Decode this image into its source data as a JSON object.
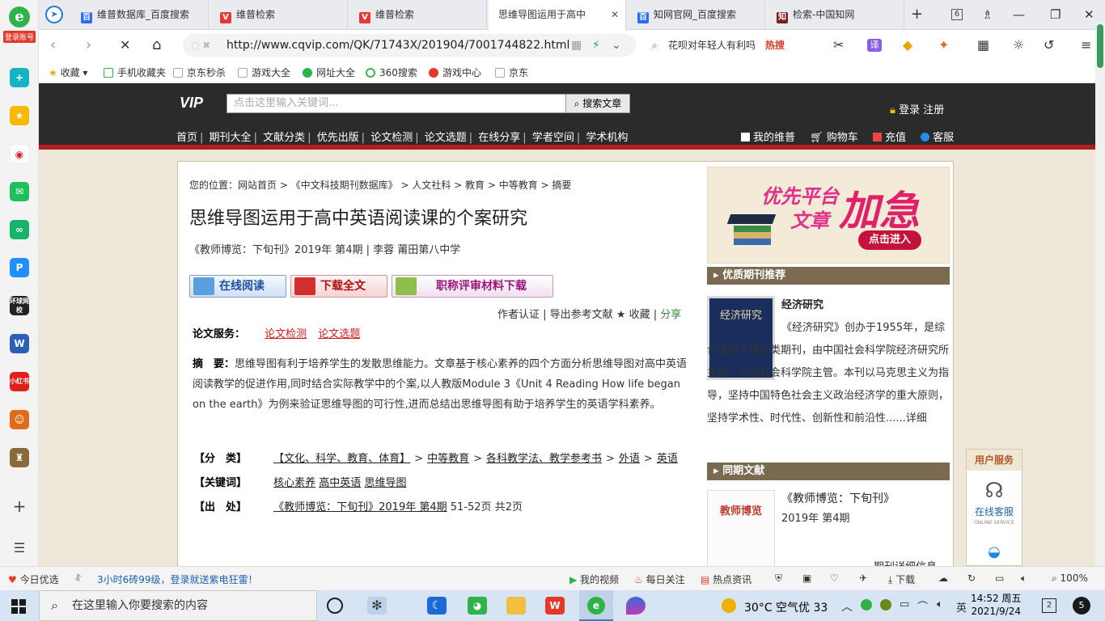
{
  "browser": {
    "sidebar": {
      "account_label": "登录账号",
      "icons": [
        "add-icon",
        "star-icon",
        "weibo-icon",
        "mail-icon",
        "link-icon",
        "p-app-icon",
        "global-school-icon",
        "word-doc-icon",
        "xiaohongshu-icon",
        "game-icon",
        "avatar-game-icon",
        "plus-icon",
        "list-icon"
      ],
      "global_school_label": "环球网校",
      "xiaohongshu_label": "小红书"
    },
    "tabs": [
      {
        "label": "维普数据库_百度搜索",
        "icon": "baidu-icon"
      },
      {
        "label": "维普检索",
        "icon": "weipu-icon"
      },
      {
        "label": "维普检索",
        "icon": "weipu-icon"
      },
      {
        "label": "思维导图运用于高中",
        "icon": "page-icon",
        "active": true
      },
      {
        "label": "知网官网_百度搜索",
        "icon": "baidu-icon"
      },
      {
        "label": "检索-中国知网",
        "icon": "cnki-icon"
      }
    ],
    "tab_count": "6",
    "url": "http://www.cqvip.com/QK/71743X/201904/7001744822.html",
    "search_text": "花呗对年轻人有利吗",
    "search_hot": "热搜",
    "bookmarks": [
      "收藏",
      "手机收藏夹",
      "京东秒杀",
      "游戏大全",
      "网址大全",
      "360搜索",
      "游戏中心",
      "京东"
    ]
  },
  "site": {
    "logo_text": "VIP",
    "search_placeholder": "点击这里输入关键词...",
    "search_button": "搜索文章",
    "login": "登录",
    "register": "注册",
    "nav": [
      "首页",
      "期刊大全",
      "文献分类",
      "优先出版",
      "论文检测",
      "论文选题",
      "在线分享",
      "学者空间",
      "学术机构"
    ],
    "tools": [
      "我的维普",
      "购物车",
      "充值",
      "客服"
    ]
  },
  "article": {
    "breadcrumb": "您的位置：网站首页 > 《中文科技期刊数据库》 > 人文社科 > 教育 > 中等教育 > 摘要",
    "title": "思维导图运用于高中英语阅读课的个案研究",
    "meta": "《教师博览：下旬刊》2019年 第4期 | 李蓉   莆田第八中学",
    "btn_read": "在线阅读",
    "btn_download": "下载全文",
    "btn_material": "职称评审材料下载",
    "author_auth": "作者认证",
    "export_ref": "导出参考文献",
    "collect": "★ 收藏",
    "share": "分享",
    "service_label": "论文服务：",
    "service_links": [
      "论文检测",
      "论文选题"
    ],
    "abstract_label": "摘　要：",
    "abstract_text": "思维导图有利于培养学生的发散思维能力。文章基于核心素养的四个方面分析思维导图对高中英语阅读教学的促进作用,同时结合实际教学中的个案,以人教版Module 3《Unit 4 Reading How life began on the earth》为例来验证思维导图的可行性,进而总结出思维导图有助于培养学生的英语学科素养。",
    "class_label": "【分　类】",
    "classes": [
      "【文化、科学、教育、体育】",
      "中等教育",
      "各科教学法、教学参考书",
      "外语",
      "英语"
    ],
    "keyword_label": "【关键词】",
    "keywords": [
      "核心素养",
      "高中英语",
      "思维导图"
    ],
    "source_label": "【出　处】",
    "source": "《教师博览：下旬刊》2019年 第4期",
    "source_pages": "51-52页 共2页"
  },
  "right": {
    "banner_line1": "优先平台",
    "banner_line2": "文章",
    "banner_big": "加急",
    "banner_btn": "点击进入",
    "rec_header": "优质期刊推荐",
    "journal_cover": "经济研究",
    "journal_name": "经济研究",
    "journal_desc": "《经济研究》创办于1955年，是综合性经济理论类期刊，由中国社会科学院经济研究所主办，中国社会科学院主管。本刊以马克思主义为指导，坚持中国特色社会主义政治经济学的重大原则，坚持学术性、时代性、创新性和前沿性......详细",
    "same_header": "同期文献",
    "same_cover": "教师博览",
    "same_name": "《教师博览：下旬刊》",
    "same_issue": "2019年 第4期",
    "same_detail": "期刊详细信息"
  },
  "user_service": {
    "header": "用户服务",
    "label": "在线客服",
    "sub": "ONLINE SERVICE"
  },
  "statusbar": {
    "today": "今日优选",
    "promo": "3小时6砖99级，登录就送紫电狂雷！",
    "video": "我的视频",
    "daily": "每日关注",
    "news": "热点资讯",
    "download": "下载",
    "zoom": "100%"
  },
  "taskbar": {
    "search_placeholder": "在这里输入你要搜索的内容",
    "weather": "30°C 空气优 33",
    "ime": "英",
    "time": "14:52 周五",
    "date": "2021/9/24",
    "notif_count": "2",
    "notif_badge": "5"
  }
}
